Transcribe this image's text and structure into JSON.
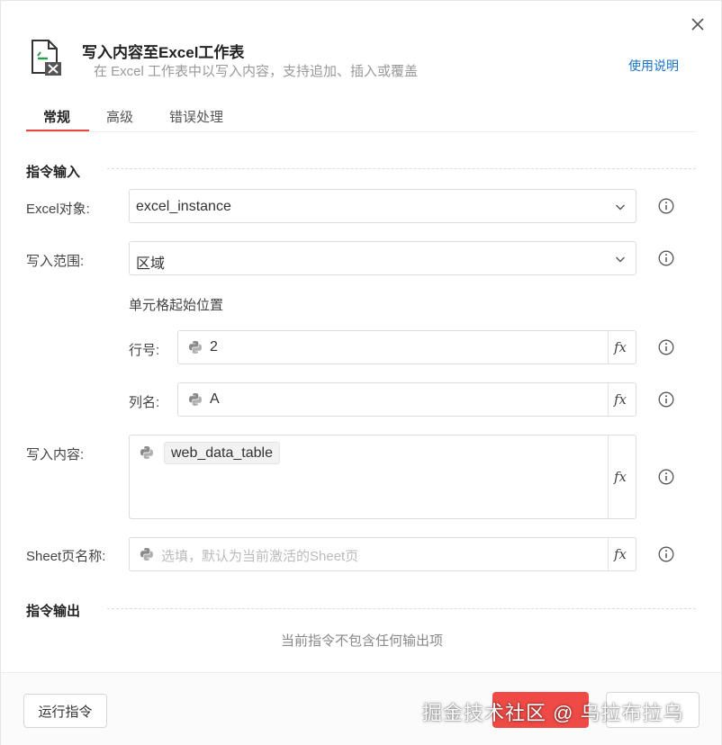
{
  "dialog": {
    "title": "写入内容至Excel工作表",
    "subtitle": "在 Excel 工作表中以写入内容，支持追加、插入或覆盖",
    "help_link": "使用说明",
    "close_icon": "close-icon",
    "header_icon": "excel-write-icon"
  },
  "tabs": [
    {
      "label": "常规",
      "active": true
    },
    {
      "label": "高级",
      "active": false
    },
    {
      "label": "错误处理",
      "active": false
    }
  ],
  "input_section": {
    "label": "指令输入",
    "excel_object": {
      "label": "Excel对象:",
      "value": "excel_instance"
    },
    "write_range": {
      "label": "写入范围:",
      "value": "区域"
    },
    "cell_start": {
      "label": "单元格起始位置",
      "row": {
        "label": "行号:",
        "value": "2"
      },
      "column": {
        "label": "列名:",
        "value": "A"
      }
    },
    "content": {
      "label": "写入内容:",
      "value": "web_data_table"
    },
    "sheet_name": {
      "label": "Sheet页名称:",
      "placeholder": "选填，默认为当前激活的Sheet页"
    }
  },
  "output_section": {
    "label": "指令输出",
    "empty_text": "当前指令不包含任何输出项"
  },
  "footer": {
    "run_label": "运行指令",
    "watermark": "掘金技术社区 @ 乌拉布拉乌"
  },
  "colors": {
    "accent": "#e8453c",
    "primary_button": "#ef4a45",
    "link": "#1a73c8"
  }
}
